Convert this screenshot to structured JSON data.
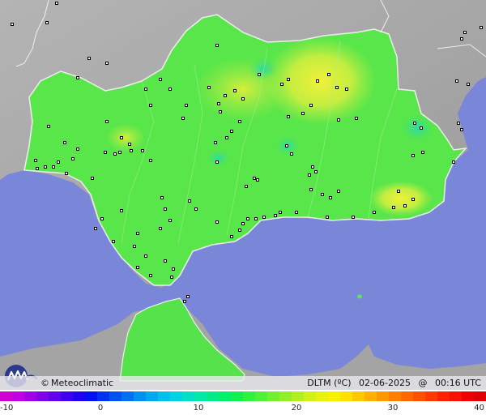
{
  "credit": {
    "copyright": "©",
    "name": "Meteoclimatic"
  },
  "title": {
    "variable": "DLTM (ºC)",
    "date": "02-06-2025",
    "sep": "@",
    "time": "00:16 UTC"
  },
  "legend": {
    "ticks": [
      "-10",
      "0",
      "10",
      "20",
      "30",
      "40"
    ],
    "range": [
      -10,
      40
    ],
    "colors": [
      "#d000d0",
      "#c000e0",
      "#a000e8",
      "#8000ec",
      "#6000ee",
      "#4000f0",
      "#2000f2",
      "#0010f4",
      "#0030f4",
      "#0050f2",
      "#0070f0",
      "#0090f0",
      "#00a8f0",
      "#00c0ec",
      "#00d4e0",
      "#00e0c8",
      "#00e8a8",
      "#00ec88",
      "#00f068",
      "#10f050",
      "#30f040",
      "#50f038",
      "#70f030",
      "#90f028",
      "#b0f020",
      "#d0f018",
      "#e8f010",
      "#f8f000",
      "#ffe000",
      "#ffc800",
      "#ffb000",
      "#ff9800",
      "#ff8000",
      "#ff6800",
      "#ff5000",
      "#ff3800",
      "#ff2000",
      "#f81000",
      "#f00000",
      "#e00000"
    ]
  },
  "map": {
    "sea_color": "#7a86d8",
    "land_color": "#a8a8a8",
    "region_color": "#5ae84c"
  }
}
